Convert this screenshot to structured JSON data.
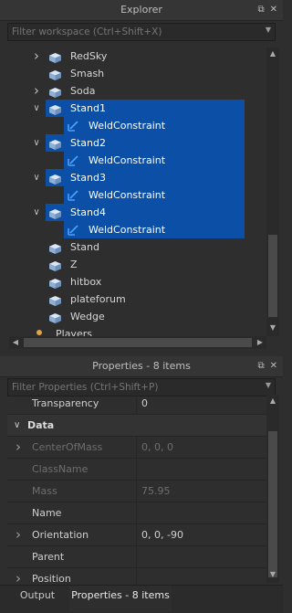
{
  "explorer": {
    "title": "Explorer",
    "filter_placeholder": "Filter workspace (Ctrl+Shift+X)",
    "items": [
      {
        "label": "RedSky",
        "icon": "part-icon",
        "expander": "collapsed",
        "selected": false,
        "indent": 0
      },
      {
        "label": "Smash",
        "icon": "part-icon",
        "expander": "none",
        "selected": false,
        "indent": 0
      },
      {
        "label": "Soda",
        "icon": "part-icon",
        "expander": "collapsed",
        "selected": false,
        "indent": 0
      },
      {
        "label": "Stand1",
        "icon": "part-icon",
        "expander": "expanded",
        "selected": true,
        "indent": 0
      },
      {
        "label": "WeldConstraint",
        "icon": "weld-constraint-icon",
        "expander": "none",
        "selected": true,
        "indent": 1
      },
      {
        "label": "Stand2",
        "icon": "part-icon",
        "expander": "expanded",
        "selected": true,
        "indent": 0
      },
      {
        "label": "WeldConstraint",
        "icon": "weld-constraint-icon",
        "expander": "none",
        "selected": true,
        "indent": 1
      },
      {
        "label": "Stand3",
        "icon": "part-icon",
        "expander": "expanded",
        "selected": true,
        "indent": 0
      },
      {
        "label": "WeldConstraint",
        "icon": "weld-constraint-icon",
        "expander": "none",
        "selected": true,
        "indent": 1
      },
      {
        "label": "Stand4",
        "icon": "part-icon",
        "expander": "expanded",
        "selected": true,
        "indent": 0
      },
      {
        "label": "WeldConstraint",
        "icon": "weld-constraint-icon",
        "expander": "none",
        "selected": true,
        "indent": 1
      },
      {
        "label": "Stand",
        "icon": "part-icon",
        "expander": "none",
        "selected": false,
        "indent": 0
      },
      {
        "label": "Z",
        "icon": "part-icon",
        "expander": "none",
        "selected": false,
        "indent": 0
      },
      {
        "label": "hitbox",
        "icon": "part-icon",
        "expander": "none",
        "selected": false,
        "indent": 0
      },
      {
        "label": "plateforum",
        "icon": "part-icon",
        "expander": "none",
        "selected": false,
        "indent": 0
      },
      {
        "label": "Wedge",
        "icon": "part-icon",
        "expander": "none",
        "selected": false,
        "indent": 0
      },
      {
        "label": "Players",
        "icon": "players-icon",
        "expander": "none",
        "selected": false,
        "indent": -1
      }
    ]
  },
  "properties": {
    "title": "Properties - 8 items",
    "filter_placeholder": "Filter Properties (Ctrl+Shift+P)",
    "rows": [
      {
        "type": "prop",
        "name": "Transparency",
        "value": "0",
        "dim": false,
        "expander": false
      },
      {
        "type": "section",
        "name": "Data"
      },
      {
        "type": "prop",
        "name": "CenterOfMass",
        "value": "0, 0, 0",
        "dim": true,
        "expander": true
      },
      {
        "type": "prop",
        "name": "ClassName",
        "value": "",
        "dim": true,
        "expander": false
      },
      {
        "type": "prop",
        "name": "Mass",
        "value": "75.95",
        "dim": true,
        "expander": false
      },
      {
        "type": "prop",
        "name": "Name",
        "value": "",
        "dim": false,
        "expander": false
      },
      {
        "type": "prop",
        "name": "Orientation",
        "value": "0, 0, -90",
        "dim": false,
        "expander": true
      },
      {
        "type": "prop",
        "name": "Parent",
        "value": "",
        "dim": false,
        "expander": false
      },
      {
        "type": "prop",
        "name": "Position",
        "value": "",
        "dim": false,
        "expander": true
      }
    ]
  },
  "tabs": [
    {
      "label": "Output",
      "active": false
    },
    {
      "label": "Properties - 8 items",
      "active": true
    }
  ],
  "colors": {
    "selection": "#0b4fa6",
    "part_icon": "#9fb9d8",
    "weld_icon": "#4aa3ff",
    "panel_bg": "#2e2e2e"
  }
}
